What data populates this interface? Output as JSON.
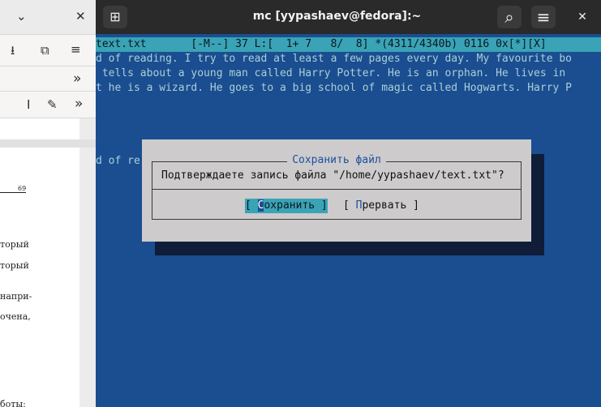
{
  "left_pane": {
    "icons": {
      "chevron": "⌄",
      "close": "✕",
      "download": "⭳",
      "puzzle": "⧉",
      "menu": "≡",
      "overflow": "»",
      "cursor": "I",
      "pen": "✎",
      "overflow2": "»"
    },
    "page_number": "69",
    "text_fragments": [
      "торый",
      "торый",
      "напри-",
      "очена,",
      "боты:"
    ]
  },
  "terminal": {
    "title": "mc [yypashaev@fedora]:~",
    "new_tab_icon": "⊞",
    "search_icon": "⌕",
    "menu_icon": "≡",
    "close_icon": "✕",
    "status_line": "text.txt       [-M--] 37 L:[  1+ 7   8/  8] *(4311/4340b) 0116 0x[*][X]",
    "lines": [
      "d of reading. I try to read at least a few pages every day. My favourite bo",
      " tells about a young man called Harry Potter. He is an orphan. He lives in",
      "t he is a wizard. He goes to a big school of magic called Hogwarts. Harry P"
    ],
    "partial_line": "d of re"
  },
  "dialog": {
    "title": "Сохранить файл",
    "message": "Подтверждаете запись файла \"/home/yypashaev/text.txt\"?",
    "save_open": "[ ",
    "save_hot": "С",
    "save_rest": "охранить ]",
    "cancel_open": "[ ",
    "cancel_hot": "П",
    "cancel_rest": "рервать ]"
  }
}
